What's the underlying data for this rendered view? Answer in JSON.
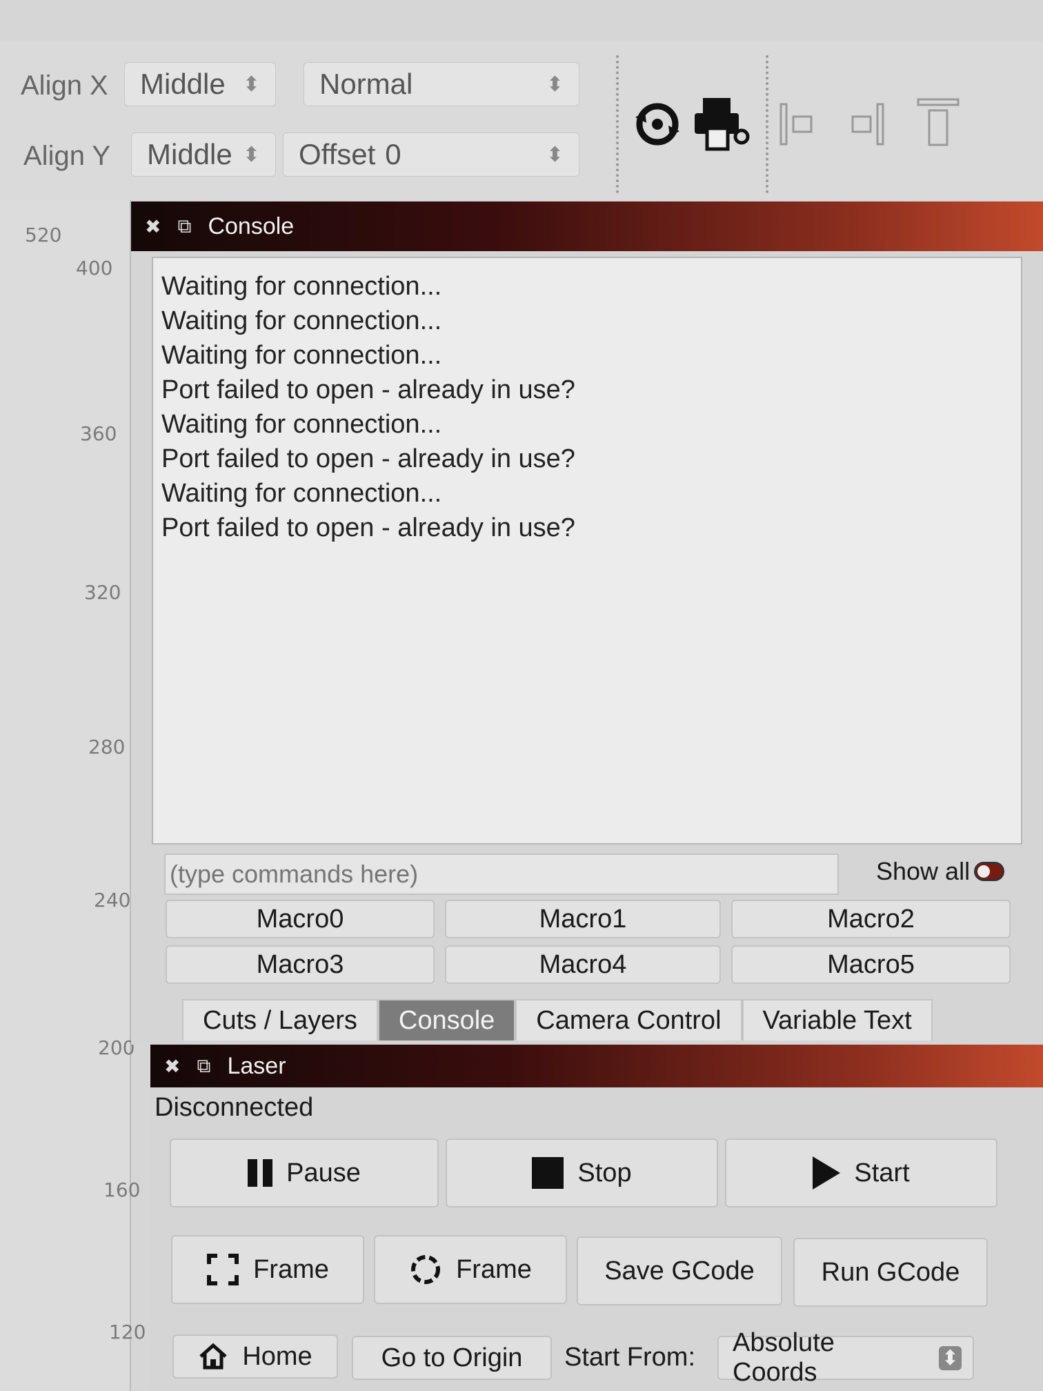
{
  "toolbar": {
    "align_x_label": "Align X",
    "align_x_value": "Middle",
    "mode_value": "Normal",
    "align_y_label": "Align Y",
    "align_y_value": "Middle",
    "offset_label": "Offset",
    "offset_value": "0",
    "icons": [
      "rotary-icon",
      "laser-machine-icon",
      "align-left-icon",
      "align-right-icon",
      "align-top-icon"
    ]
  },
  "ruler": {
    "ticks": [
      "520",
      "400",
      "360",
      "320",
      "280",
      "240",
      "200",
      "160",
      "120"
    ]
  },
  "console": {
    "title": "Console",
    "lines": [
      "Waiting for connection...",
      "Waiting for connection...",
      "Waiting for connection...",
      "Port failed to open - already in use?",
      "Waiting for connection...",
      "Port failed to open - already in use?",
      "Waiting for connection...",
      "Port failed to open - already in use?"
    ],
    "input_placeholder": "(type commands here)",
    "show_all_label": "Show all",
    "show_all_checked": true,
    "macros": [
      "Macro0",
      "Macro1",
      "Macro2",
      "Macro3",
      "Macro4",
      "Macro5"
    ]
  },
  "tabs": [
    {
      "label": "Cuts / Layers",
      "active": false
    },
    {
      "label": "Console",
      "active": true
    },
    {
      "label": "Camera Control",
      "active": false
    },
    {
      "label": "Variable Text",
      "active": false
    }
  ],
  "laser": {
    "title": "Laser",
    "status": "Disconnected",
    "pause_label": "Pause",
    "stop_label": "Stop",
    "start_label": "Start",
    "frame_rect_label": "Frame",
    "frame_round_label": "Frame",
    "save_gcode_label": "Save GCode",
    "run_gcode_label": "Run GCode",
    "home_label": "Home",
    "go_to_origin_label": "Go to Origin",
    "start_from_label": "Start From:",
    "start_from_value": "Absolute Coords"
  },
  "colors": {
    "title_bar_start": "#140808",
    "title_bar_end": "#c24a2c",
    "active_tab": "#7c7c7c",
    "toggle_on": "#7a1b12"
  }
}
